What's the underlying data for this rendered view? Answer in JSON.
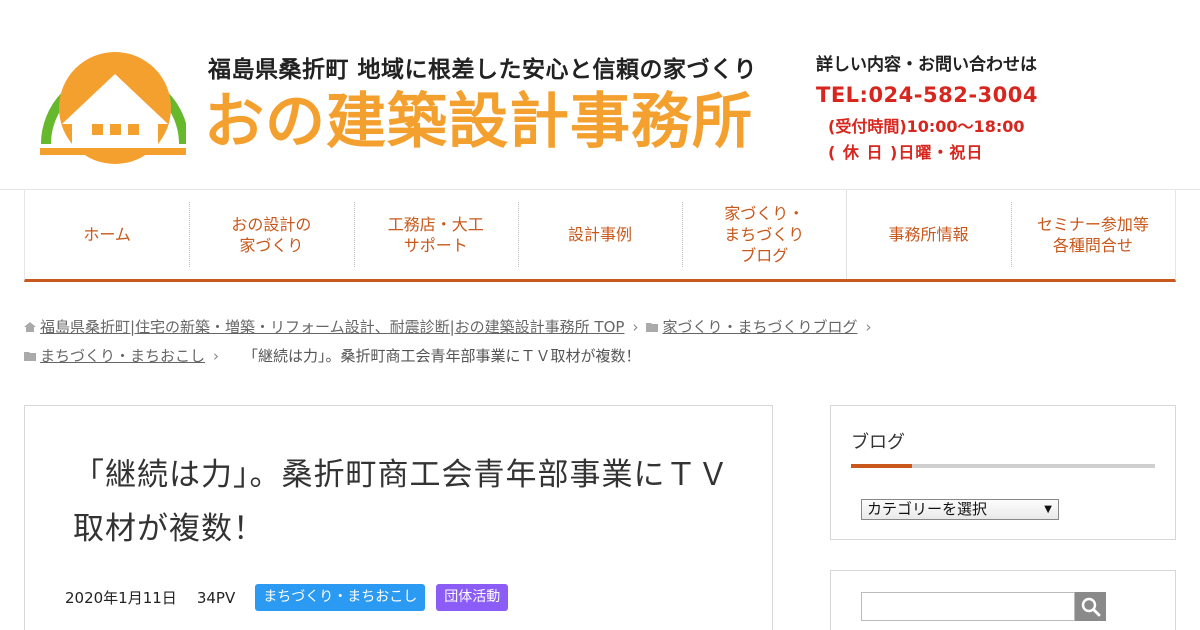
{
  "header": {
    "tagline": "福島県桑折町 地域に根差した安心と信頼の家づくり",
    "company_name": "おの建築設計事務所",
    "contact": {
      "title": "詳しい内容・お問い合わせは",
      "tel": "TEL:024-582-3004",
      "hours": "(受付時間)10:00〜18:00",
      "holiday": "( 休 日 )日曜・祝日"
    },
    "colors": {
      "brand_orange": "#f4a02e",
      "logo_green": "#66b92c",
      "contact_red": "#d7261e"
    }
  },
  "nav": {
    "items": [
      {
        "label": "ホーム"
      },
      {
        "label": "おの設計の\n家づくり"
      },
      {
        "label": "工務店・大工\nサポート"
      },
      {
        "label": "設計事例"
      },
      {
        "label": "家づくり・\nまちづくり\nブログ"
      },
      {
        "label": "事務所情報"
      },
      {
        "label": "セミナー参加等\n各種問合せ"
      }
    ],
    "accent_color": "#c8581b"
  },
  "breadcrumb": {
    "home_label": "福島県桑折町|住宅の新築・増築・リフォーム設計、耐震診断|おの建築設計事務所 TOP",
    "category_label": "家づくり・まちづくりブログ",
    "subcategory_label": "まちづくり・まちおこし",
    "current_label": "「継続は力」。桑折町商工会青年部事業にＴＶ取材が複数！",
    "icons": {
      "home": "home-icon",
      "folder": "folder-icon"
    }
  },
  "article": {
    "title": "「継続は力」。桑折町商工会青年部事業にＴＶ取材が複数！",
    "date": "2020年1月11日",
    "pv": "34PV",
    "tags": [
      {
        "label": "まちづくり・まちおこし",
        "color": "#2b9af3"
      },
      {
        "label": "団体活動",
        "color": "#8b5cf6"
      }
    ]
  },
  "sidebar": {
    "blog_widget": {
      "title": "ブログ",
      "select_value": "カテゴリーを選択"
    },
    "search_widget": {
      "placeholder": "",
      "button_icon": "search-icon"
    }
  }
}
